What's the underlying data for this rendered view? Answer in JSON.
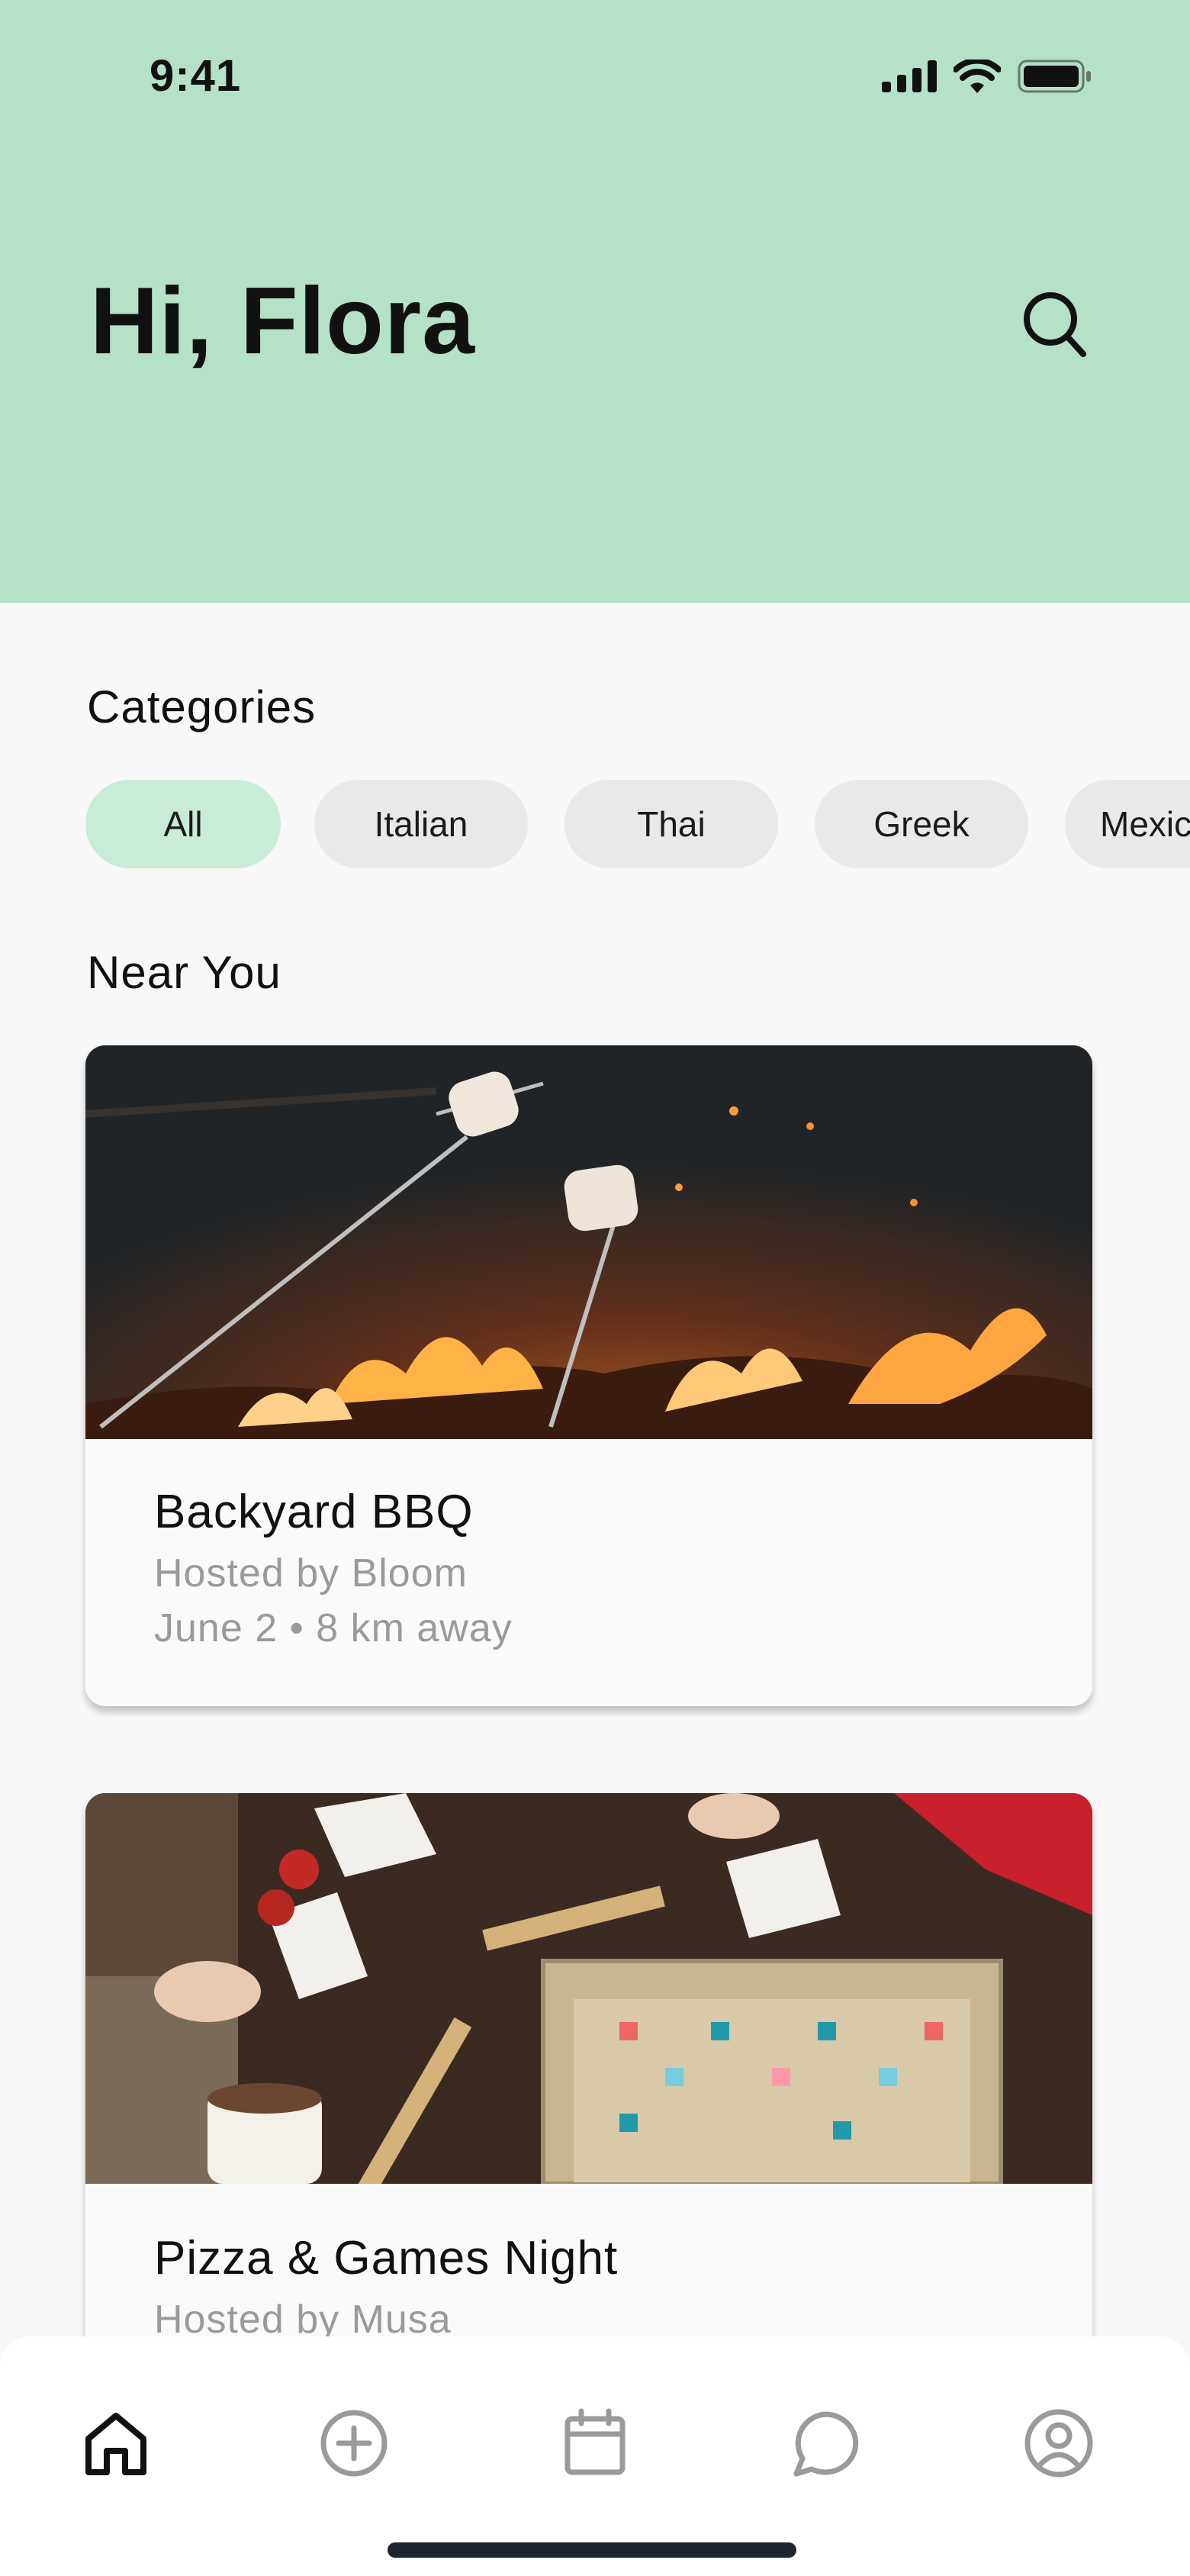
{
  "status_bar": {
    "time": "9:41"
  },
  "header": {
    "greeting": "Hi, Flora"
  },
  "categories": {
    "title": "Categories",
    "items": [
      {
        "label": "All",
        "active": true
      },
      {
        "label": "Italian",
        "active": false
      },
      {
        "label": "Thai",
        "active": false
      },
      {
        "label": "Greek",
        "active": false
      },
      {
        "label": "Mexican",
        "active": false
      }
    ]
  },
  "near_you": {
    "title": "Near You",
    "events": [
      {
        "title": "Backyard BBQ",
        "host": "Hosted by Bloom",
        "meta": "June 2 • 8 km away",
        "image": "campfire-marshmallows-photo"
      },
      {
        "title": "Pizza & Games Night",
        "host": "Hosted by Musa",
        "image": "board-games-photo"
      }
    ]
  },
  "bottom_nav": {
    "items": [
      {
        "icon": "home-icon",
        "active": true
      },
      {
        "icon": "plus-circle-icon",
        "active": false
      },
      {
        "icon": "calendar-icon",
        "active": false
      },
      {
        "icon": "chat-bubble-icon",
        "active": false
      },
      {
        "icon": "profile-icon",
        "active": false
      }
    ]
  },
  "colors": {
    "header_bg": "#b5e1c9",
    "chip_active": "#c9ecd9",
    "chip_inactive": "#e9e9e9",
    "nav_active": "#111111",
    "nav_inactive": "#9a9a9a"
  }
}
